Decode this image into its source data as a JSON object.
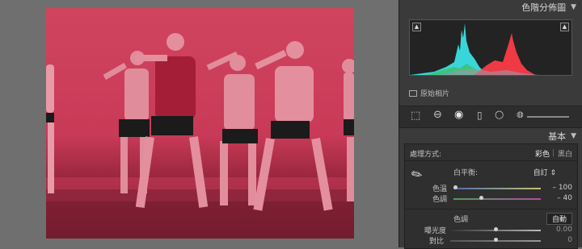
{
  "histogram": {
    "title": "色階分佈圖",
    "clip_left": "▲",
    "clip_right": "▲",
    "original_photo_label": "原始相片"
  },
  "basic": {
    "title": "基本",
    "treatment_label": "處理方式:",
    "treatment_color": "彩色",
    "treatment_bw": "黑白",
    "wb_label": "白平衡:",
    "wb_value": "自訂 ⇕",
    "temp_label": "色溫",
    "temp_value": "– 100",
    "tint_label": "色調",
    "tint_value": "– 40",
    "tone_label": "色調",
    "auto_label": "自動",
    "exposure_label": "曝光度",
    "exposure_value": "0.00",
    "contrast_label": "對比",
    "contrast_value": "0"
  },
  "colors": {
    "panel": "#3a3a3a",
    "photo_tint": "#c93a58",
    "cyan": "#38d6d9",
    "red": "#ef3a44"
  }
}
